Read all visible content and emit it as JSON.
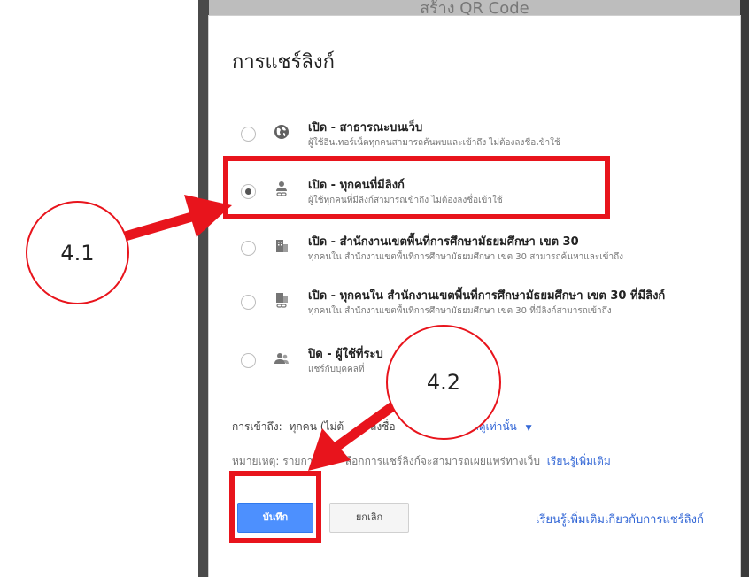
{
  "background": {
    "top_text": "สร้าง QR Code"
  },
  "dialog": {
    "title": "การแชร์ลิงก์",
    "options": [
      {
        "icon": "globe-icon",
        "title": "เปิด - สาธารณะบนเว็บ",
        "desc": "ผู้ใช้อินเทอร์เน็ตทุกคนสามารถค้นพบและเข้าถึง ไม่ต้องลงชื่อเข้าใช้",
        "checked": false
      },
      {
        "icon": "person-link-icon",
        "title": "เปิด - ทุกคนที่มีลิงก์",
        "desc": "ผู้ใช้ทุกคนที่มีลิงก์สามารถเข้าถึง ไม่ต้องลงชื่อเข้าใช้",
        "checked": true
      },
      {
        "icon": "building-icon",
        "title": "เปิด - สำนักงานเขตพื้นที่การศึกษามัธยมศึกษา เขต 30",
        "desc": "ทุกคนใน สำนักงานเขตพื้นที่การศึกษามัธยมศึกษา เขต 30 สามารถค้นหาและเข้าถึง",
        "checked": false
      },
      {
        "icon": "building-link-icon",
        "title": "เปิด - ทุกคนใน สำนักงานเขตพื้นที่การศึกษามัธยมศึกษา เขต 30 ที่มีลิงก์",
        "desc": "ทุกคนใน สำนักงานเขตพื้นที่การศึกษามัธยมศึกษา เขต 30 ที่มีลิงก์สามารถเข้าถึง",
        "checked": false
      },
      {
        "icon": "people-icon",
        "title": "ปิด - ผู้ใช้ที่ระบ",
        "desc": "แชร์กับบุคคลที่",
        "checked": false
      }
    ],
    "access_label": "การเข้าถึง:",
    "access_value": "ทุกคน (ไม่ต้",
    "access_value_end": "ลงชื่อ",
    "access_link": "สามารถดูเท่านั้น",
    "access_caret": "▼",
    "note_prefix": "หมายเหตุ: รายการ",
    "note_suffix": "ลือกการแชร์ลิงก์จะสามารถเผยแพร่ทางเว็บ",
    "note_link": "เรียนรู้เพิ่มเติม",
    "save_label": "บันทึก",
    "cancel_label": "ยกเลิก",
    "learn_more_link": "เรียนรู้เพิ่มเติมเกี่ยวกับการแชร์ลิงก์"
  },
  "annotations": {
    "callout_1": "4.1",
    "callout_2": "4.2",
    "highlight_color": "#e8141c"
  }
}
